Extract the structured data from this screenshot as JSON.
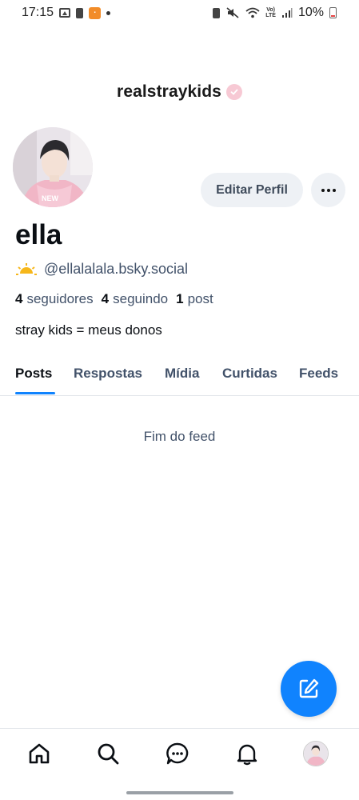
{
  "status_bar": {
    "time": "17:15",
    "battery_percent": "10%",
    "network": "LTE"
  },
  "header": {
    "title": "realstraykids"
  },
  "profile": {
    "display_name": "ella",
    "handle": "@ellalalala.bsky.social",
    "followers_count": "4",
    "followers_label": "seguidores",
    "following_count": "4",
    "following_label": "seguindo",
    "posts_count": "1",
    "posts_label": "post",
    "bio": "stray kids = meus donos",
    "edit_button_label": "Editar Perfil"
  },
  "tabs": [
    {
      "label": "Posts",
      "active": true
    },
    {
      "label": "Respostas",
      "active": false
    },
    {
      "label": "Mídia",
      "active": false
    },
    {
      "label": "Curtidas",
      "active": false
    },
    {
      "label": "Feeds",
      "active": false
    }
  ],
  "feed": {
    "end_message": "Fim do feed"
  },
  "colors": {
    "accent": "#1083fe",
    "muted_text": "#42526a",
    "button_bg": "#eef1f5"
  },
  "icons": {
    "fab": "compose-icon",
    "nav": [
      "home-icon",
      "search-icon",
      "chat-icon",
      "bell-icon",
      "profile-avatar"
    ]
  }
}
